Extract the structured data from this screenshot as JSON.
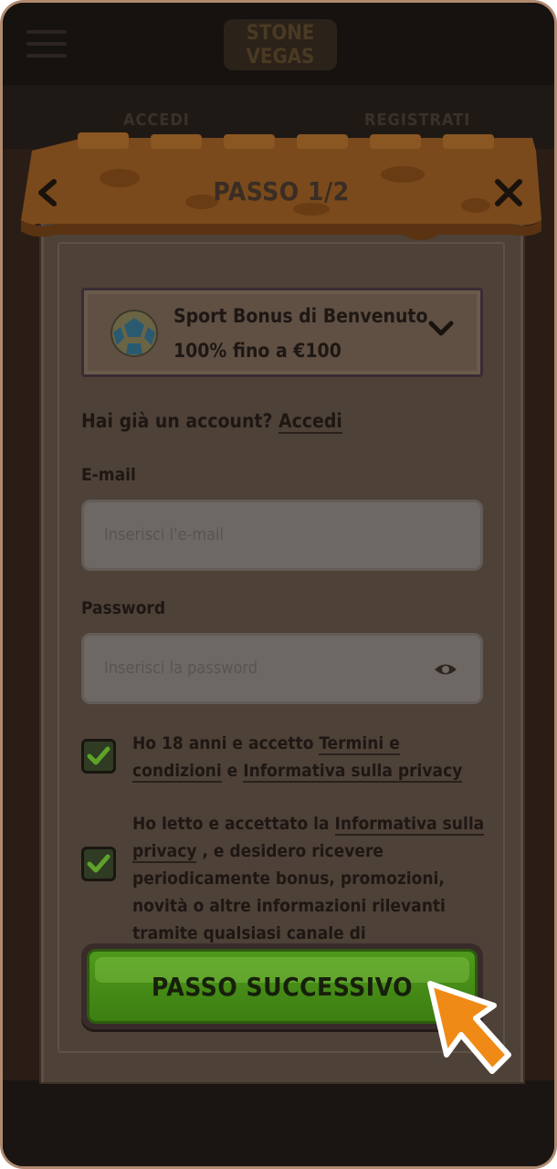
{
  "background": {
    "logo_text": "STONE VEGAS",
    "tabs": [
      "ACCEDI",
      "REGISTRATI"
    ]
  },
  "header": {
    "back_icon": "chevron-left-icon",
    "title": "PASSO 1/2",
    "close_icon": "close-icon"
  },
  "bonus": {
    "icon": "soccer-ball-icon",
    "title": "Sport Bonus di Benvenuto",
    "subtitle": "100% fino a €100",
    "dropdown_icon": "chevron-down-icon"
  },
  "account": {
    "question": "Hai già un account?",
    "login_link": "Accedi"
  },
  "email": {
    "label": "E-mail",
    "placeholder": "Inserisci l'e-mail"
  },
  "password": {
    "label": "Password",
    "placeholder": "Inserisci la password",
    "toggle_icon": "eye-icon"
  },
  "consents": {
    "age": {
      "checked": true,
      "text_before": "Ho 18 anni e accetto ",
      "terms_link": "Termini e condizioni",
      "text_mid": " e ",
      "privacy_link": "Informativa sulla privacy"
    },
    "marketing": {
      "checked": true,
      "text_before": "Ho letto e accettato la ",
      "privacy_link": "Informativa sulla privacy",
      "text_after": " , e desidero ricevere periodicamente bonus, promozioni, novità o altre informazioni rilevanti tramite qualsiasi canale di comunicazione."
    }
  },
  "next_button": {
    "label": "PASSO SUCCESSIVO"
  },
  "colors": {
    "awning": "#7a4a1c",
    "button_green": "#4f9a1c",
    "pointer_orange": "#f08a16"
  }
}
